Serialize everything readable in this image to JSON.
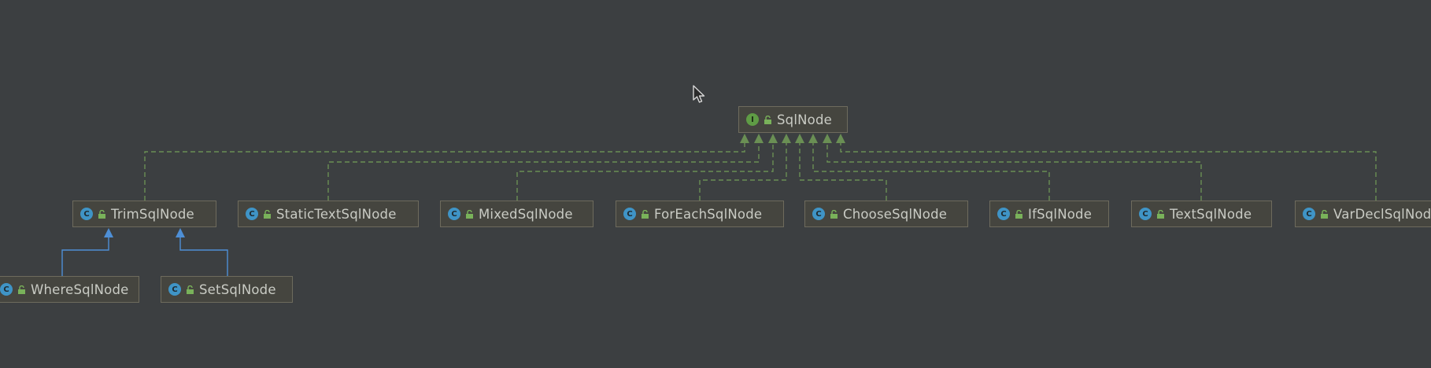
{
  "diagram": {
    "colors": {
      "background": "#3c3f41",
      "node_fill": "#45453f",
      "node_border": "#6e6b5d",
      "implements_edge": "#6a8f54",
      "extends_edge": "#4e8fd6",
      "class_badge": "#3f94c6",
      "interface_badge": "#5f9c45"
    },
    "nodes": {
      "sqlnode": {
        "label": "SqlNode",
        "badge": "I",
        "icon": "interface-icon"
      },
      "trim": {
        "label": "TrimSqlNode",
        "badge": "C",
        "icon": "class-icon"
      },
      "statictext": {
        "label": "StaticTextSqlNode",
        "badge": "C",
        "icon": "class-icon"
      },
      "mixed": {
        "label": "MixedSqlNode",
        "badge": "C",
        "icon": "class-icon"
      },
      "foreach": {
        "label": "ForEachSqlNode",
        "badge": "C",
        "icon": "class-icon"
      },
      "choose": {
        "label": "ChooseSqlNode",
        "badge": "C",
        "icon": "class-icon"
      },
      "if": {
        "label": "IfSqlNode",
        "badge": "C",
        "icon": "class-icon"
      },
      "text": {
        "label": "TextSqlNode",
        "badge": "C",
        "icon": "class-icon"
      },
      "vardecl": {
        "label": "VarDeclSqlNode",
        "badge": "C",
        "icon": "class-icon"
      },
      "where": {
        "label": "WhereSqlNode",
        "badge": "C",
        "icon": "class-icon"
      },
      "set": {
        "label": "SetSqlNode",
        "badge": "C",
        "icon": "class-icon"
      }
    },
    "edges": [
      {
        "from": "trim",
        "to": "sqlnode",
        "kind": "implements"
      },
      {
        "from": "statictext",
        "to": "sqlnode",
        "kind": "implements"
      },
      {
        "from": "mixed",
        "to": "sqlnode",
        "kind": "implements"
      },
      {
        "from": "foreach",
        "to": "sqlnode",
        "kind": "implements"
      },
      {
        "from": "choose",
        "to": "sqlnode",
        "kind": "implements"
      },
      {
        "from": "if",
        "to": "sqlnode",
        "kind": "implements"
      },
      {
        "from": "text",
        "to": "sqlnode",
        "kind": "implements"
      },
      {
        "from": "vardecl",
        "to": "sqlnode",
        "kind": "implements"
      },
      {
        "from": "where",
        "to": "trim",
        "kind": "extends"
      },
      {
        "from": "set",
        "to": "trim",
        "kind": "extends"
      }
    ],
    "cursor_icon": "mouse-pointer-icon"
  }
}
